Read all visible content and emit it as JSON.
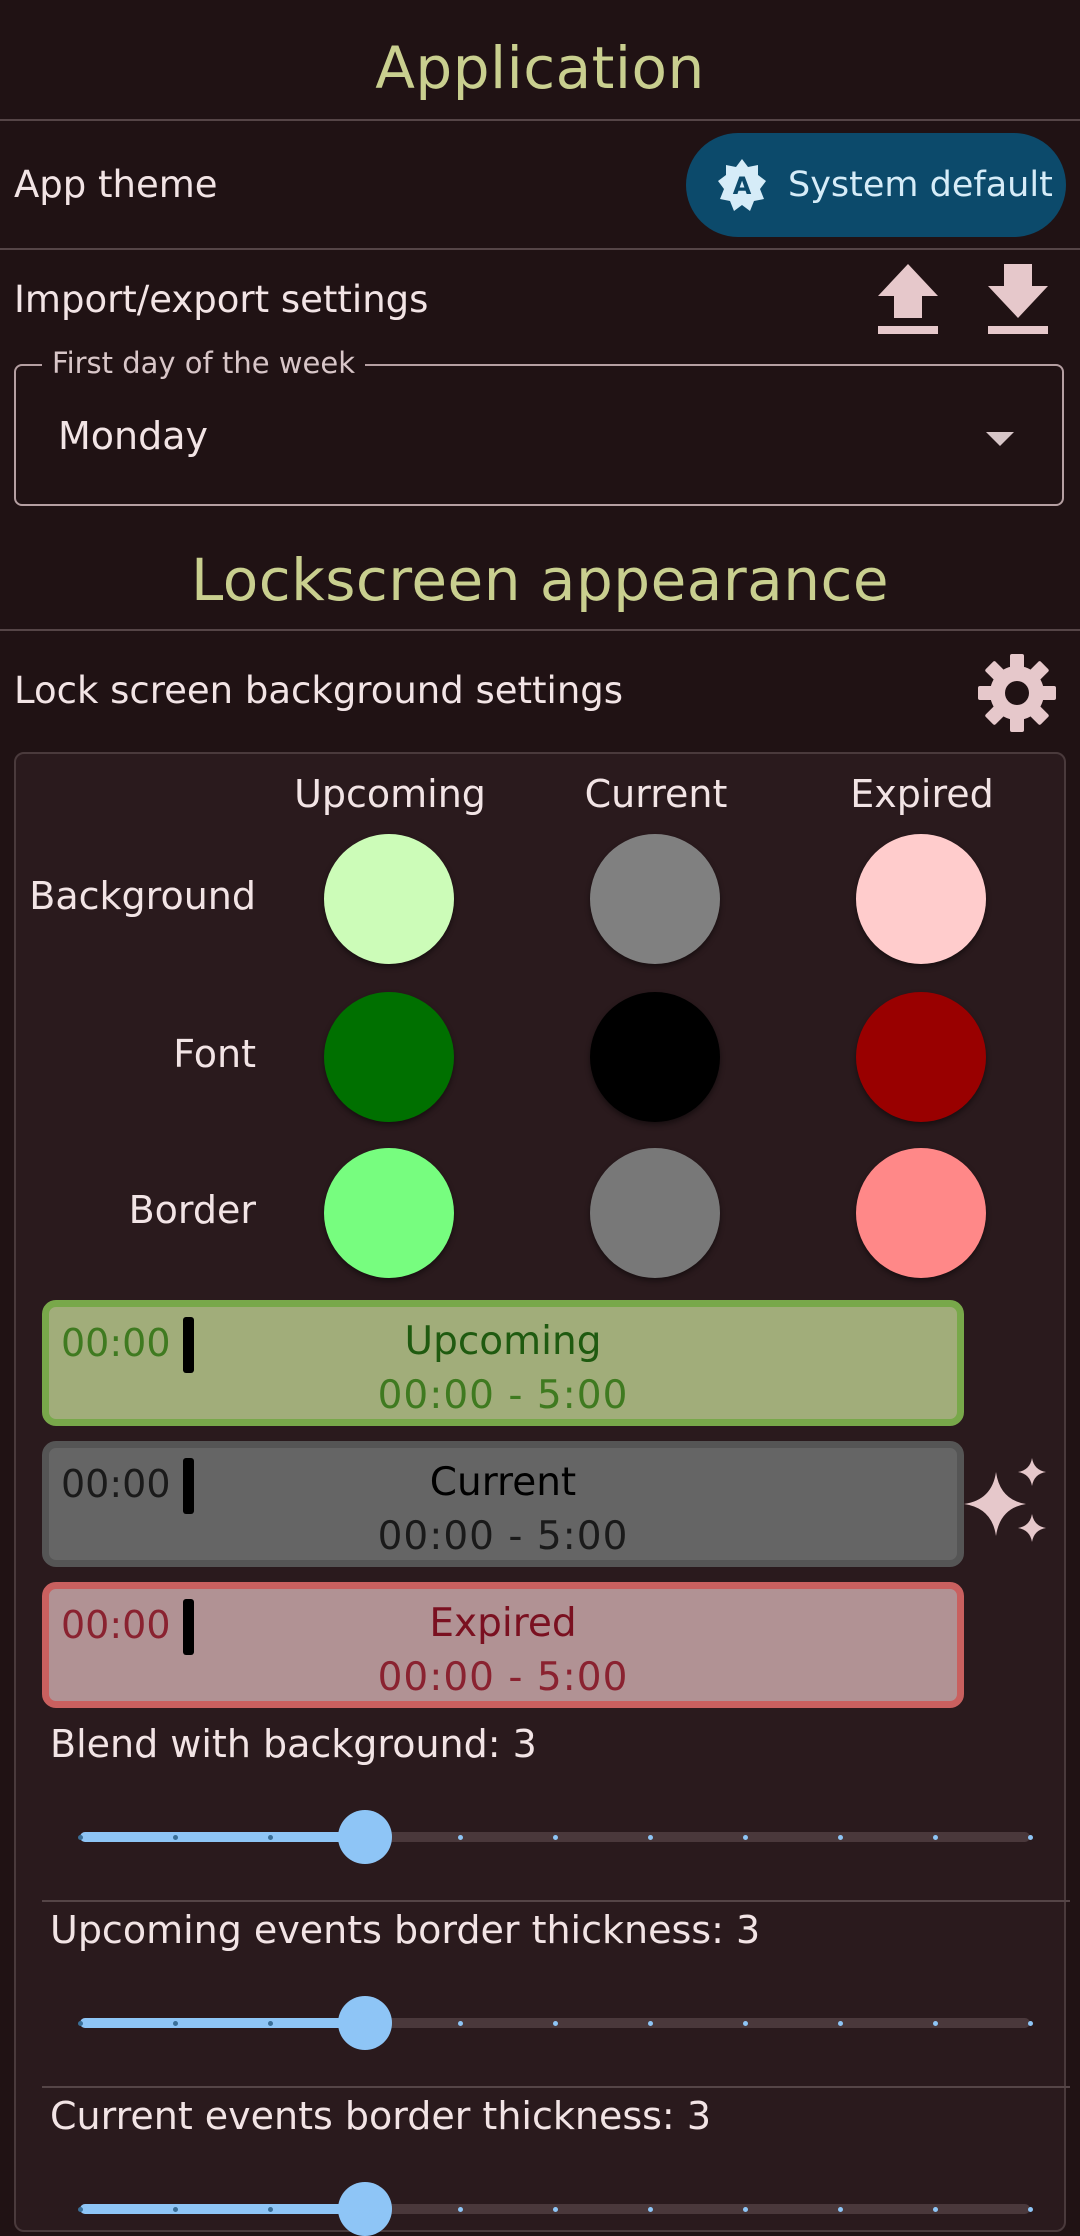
{
  "application": {
    "title": "Application",
    "app_theme_label": "App theme",
    "theme_value": "System default",
    "theme_badge": "A",
    "import_export_label": "Import/export settings",
    "first_day_legend": "First day of the week",
    "first_day_value": "Monday"
  },
  "lockscreen": {
    "title": "Lockscreen appearance",
    "bg_settings_label": "Lock screen background settings",
    "columns": [
      "Upcoming",
      "Current",
      "Expired"
    ],
    "rows": [
      {
        "name": "Background",
        "colors": [
          "#ccfcb8",
          "#808080",
          "#ffcccc"
        ]
      },
      {
        "name": "Font",
        "colors": [
          "#007000",
          "#000000",
          "#990000"
        ]
      },
      {
        "name": "Border",
        "colors": [
          "#77fd7f",
          "#787878",
          "#ff8888"
        ]
      }
    ],
    "events": [
      {
        "time": "00:00",
        "title": "Upcoming",
        "range": "00:00 - 5:00"
      },
      {
        "time": "00:00",
        "title": "Current",
        "range": "00:00 - 5:00"
      },
      {
        "time": "00:00",
        "title": "Expired",
        "range": "00:00 - 5:00"
      }
    ],
    "sliders": [
      {
        "label": "Blend with background: 3",
        "value": 3,
        "max": 10
      },
      {
        "label": "Upcoming events border thickness: 3",
        "value": 3,
        "max": 10
      },
      {
        "label": "Current events border thickness: 3",
        "value": 3,
        "max": 10
      }
    ]
  },
  "colors": {
    "accent_title": "#c9cf8f",
    "slider_active": "#8ec5f6",
    "pill_bg": "#0c4a6b",
    "event_upcoming_bg": "#a1ad7a",
    "event_upcoming_border": "#78a84a",
    "event_current_bg": "#656565",
    "event_current_border": "#555555",
    "event_expired_bg": "#b19294",
    "event_expired_border": "#c9605f"
  },
  "icons": {
    "upload": "upload-icon",
    "download": "download-icon",
    "gear": "gear-icon",
    "sparkle": "sparkle-icon"
  }
}
